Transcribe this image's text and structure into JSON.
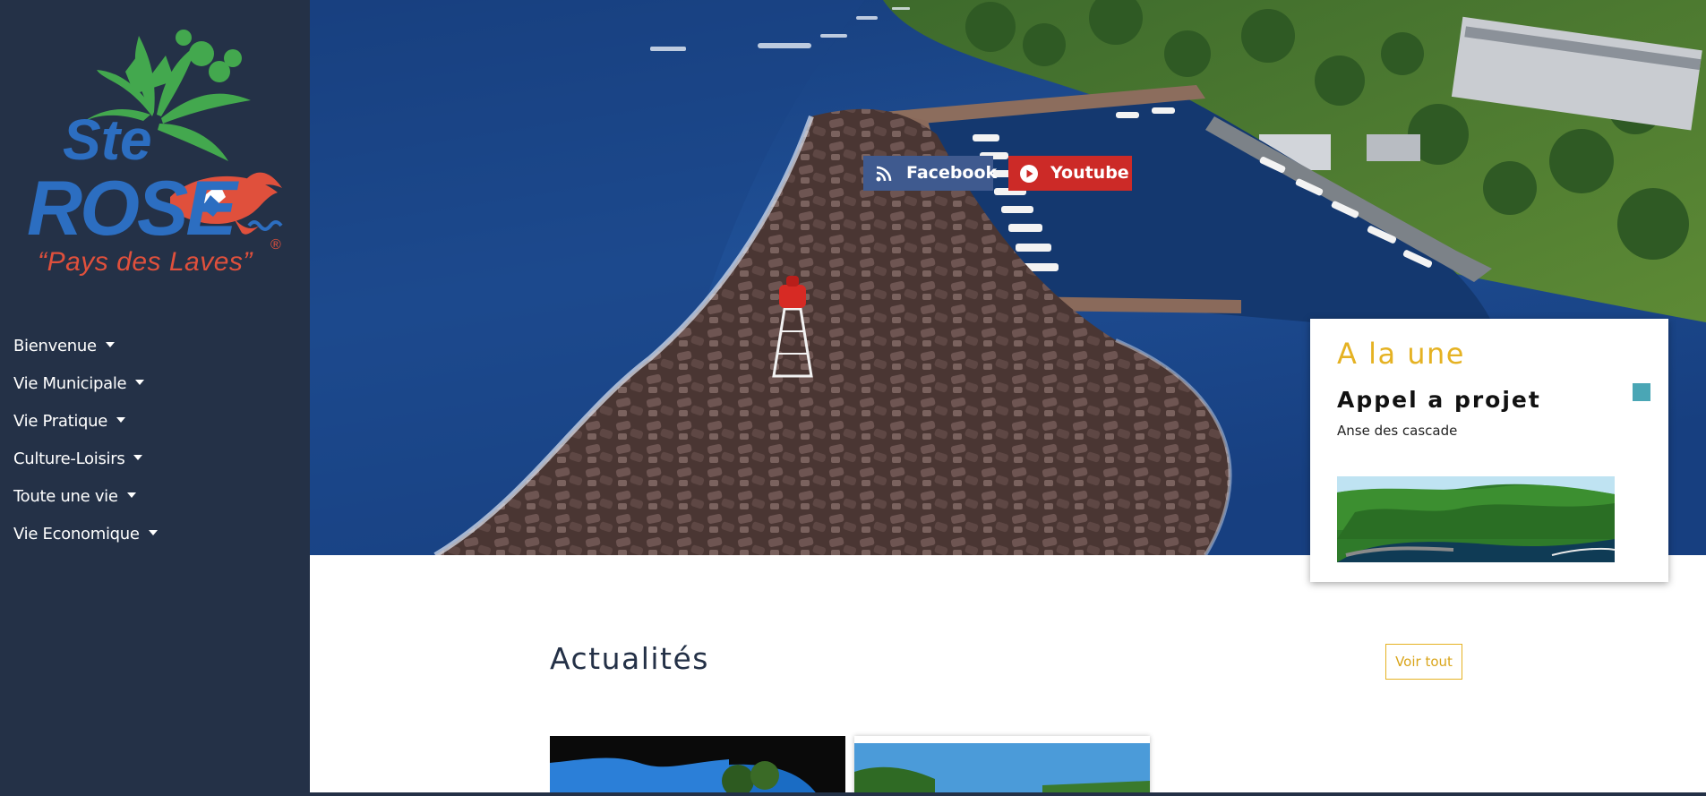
{
  "sidebar": {
    "logo": {
      "text_top": "Ste",
      "text_main": "ROSE",
      "tagline": "“Pays des Laves”",
      "registered": "®",
      "colors": {
        "blue": "#2c6ec1",
        "green": "#43a84e",
        "red": "#e0503c"
      }
    },
    "nav": [
      {
        "label": "Bienvenue"
      },
      {
        "label": "Vie Municipale"
      },
      {
        "label": "Vie Pratique"
      },
      {
        "label": "Culture-Loisirs"
      },
      {
        "label": "Toute une vie"
      },
      {
        "label": "Vie Economique"
      }
    ]
  },
  "hero": {
    "social": {
      "facebook": {
        "label": "Facebook",
        "icon": "rss-icon",
        "color": "#3f5a8f"
      },
      "youtube": {
        "label": "Youtube",
        "icon": "play-circle-icon",
        "color": "#cc2a27"
      }
    }
  },
  "a_la_une": {
    "title": "A la une",
    "heading": "Appel a projet",
    "subtitle": "Anse des cascade",
    "accent": "#e5b223",
    "indicator_color": "#4aa6b5"
  },
  "actualites": {
    "title": "Actualités",
    "voir_tout": "Voir tout"
  },
  "colors": {
    "sidebar_bg": "#243147"
  }
}
